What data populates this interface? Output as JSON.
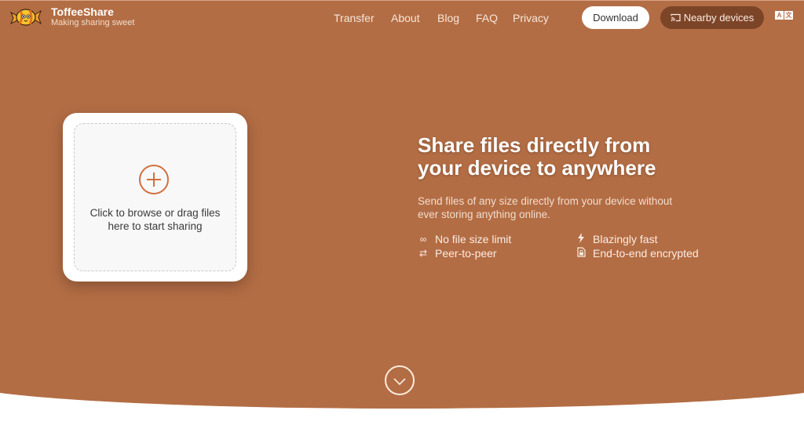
{
  "header": {
    "brand_name": "ToffeeShare",
    "brand_tagline": "Making sharing sweet",
    "nav": [
      "Transfer",
      "About",
      "Blog",
      "FAQ",
      "Privacy"
    ],
    "download_label": "Download",
    "nearby_label": "Nearby devices",
    "lang_icons": [
      "A",
      "文"
    ]
  },
  "dropzone": {
    "text_line1": "Click to browse or drag files",
    "text_line2": "here to start sharing"
  },
  "hero": {
    "headline_line1": "Share files directly from",
    "headline_line2": "your device to anywhere",
    "subtext_line1": "Send files of any size directly from your device without",
    "subtext_line2": "ever storing anything online.",
    "features": [
      {
        "icon": "infinity-icon",
        "glyph": "∞",
        "label": "No file size limit"
      },
      {
        "icon": "lightning-icon",
        "glyph": "⚡",
        "label": "Blazingly fast"
      },
      {
        "icon": "swap-icon",
        "glyph": "⇄",
        "label": "Peer-to-peer"
      },
      {
        "icon": "lock-file-icon",
        "glyph": "🔒",
        "label": "End-to-end encrypted"
      }
    ]
  },
  "colors": {
    "brand": "#b36d44",
    "accent": "#d26f3e",
    "nearby_button": "#7d4528"
  }
}
